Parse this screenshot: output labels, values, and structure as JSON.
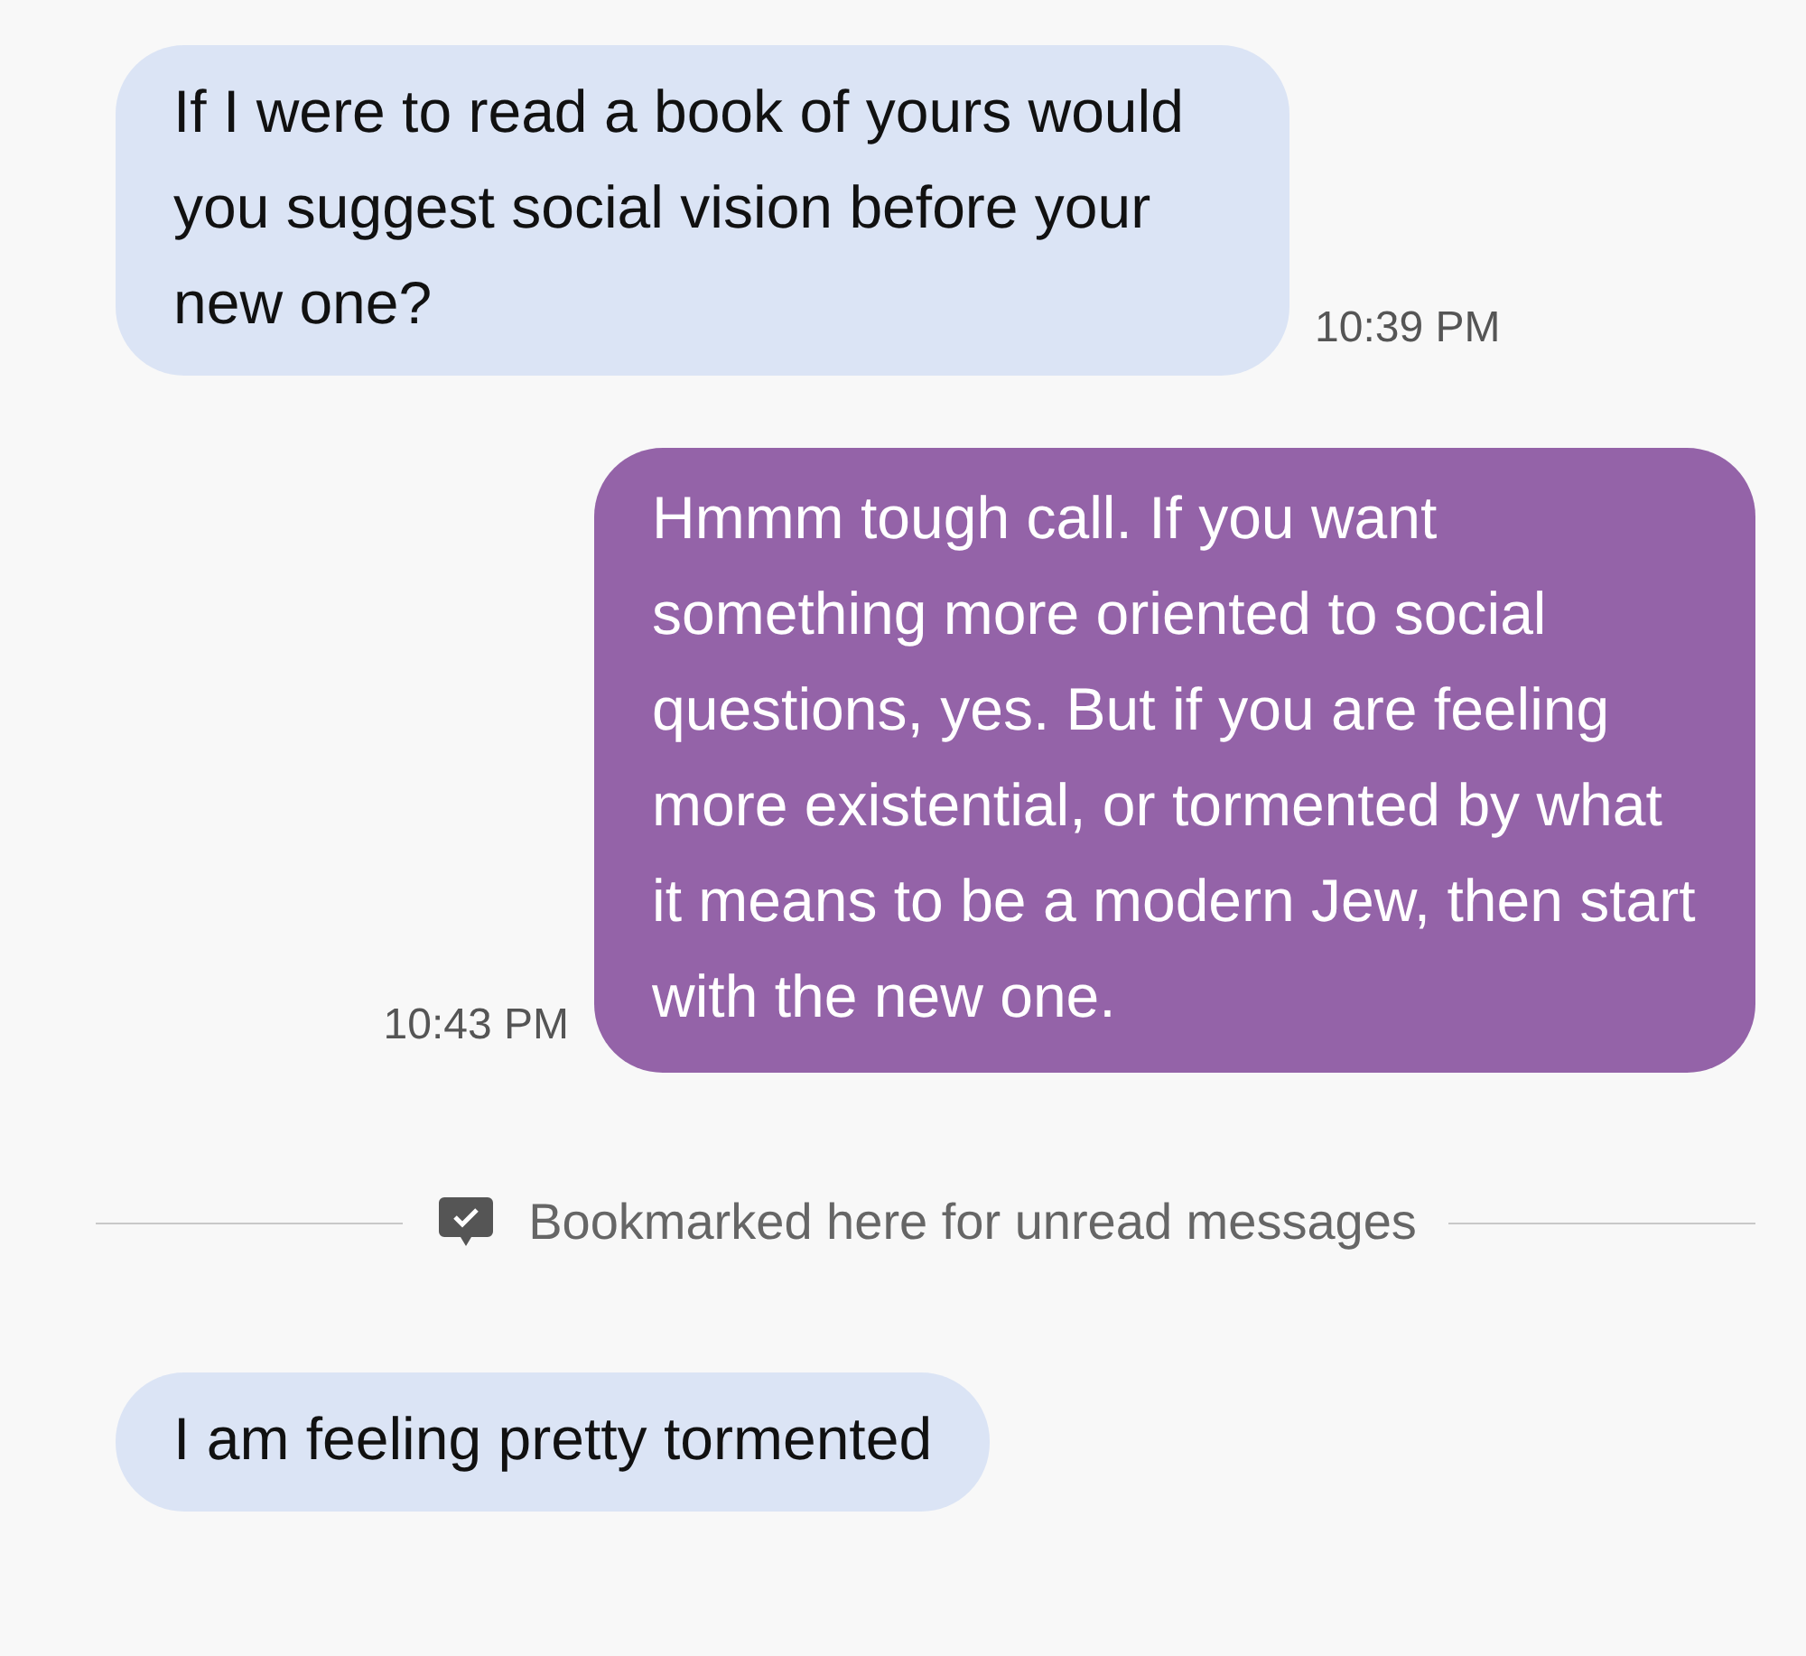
{
  "messages": [
    {
      "kind": "incoming",
      "text": "If I were to read a book of yours would you suggest social vision before your new one?",
      "time": "10:39 PM"
    },
    {
      "kind": "outgoing",
      "text": "Hmmm tough call. If you want something more oriented to social questions, yes. But if you are feeling more existential, or tormented by what it means to be a modern Jew, then start with the new one.",
      "time": "10:43 PM"
    },
    {
      "kind": "divider",
      "text": "Bookmarked here for unread messages"
    },
    {
      "kind": "incoming",
      "text": "I am feeling pretty tormented"
    }
  ]
}
